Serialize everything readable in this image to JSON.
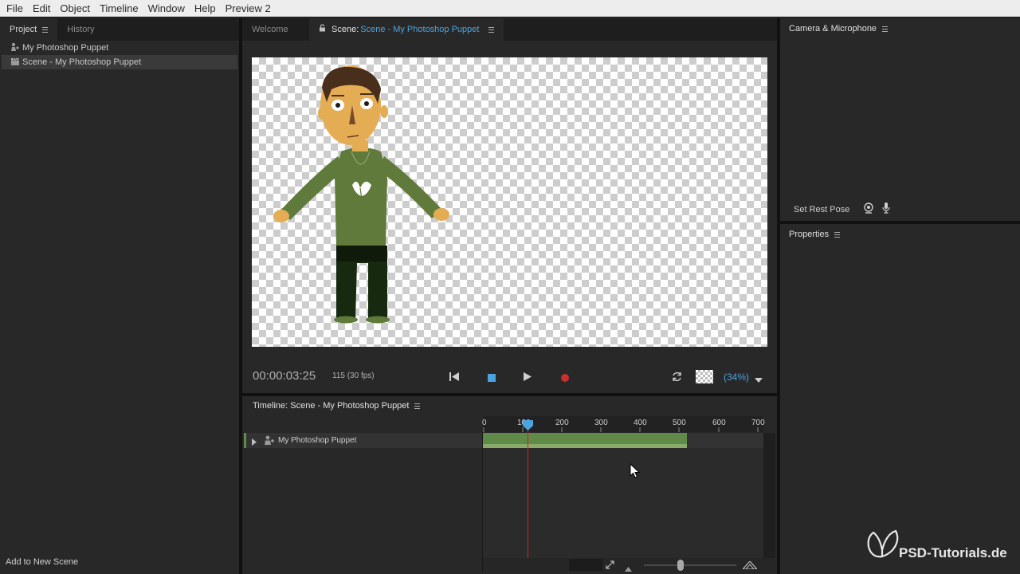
{
  "menu": [
    "File",
    "Edit",
    "Object",
    "Timeline",
    "Window",
    "Help",
    "Preview 2"
  ],
  "left_panel": {
    "tabs": [
      "Project",
      "History"
    ],
    "items": [
      "My Photoshop Puppet",
      "Scene - My Photoshop Puppet"
    ],
    "footer": "Add to New Scene"
  },
  "scene_panel": {
    "tab_welcome": "Welcome",
    "tab_scene_prefix": "Scene:",
    "tab_scene_name": "Scene - My Photoshop Puppet",
    "timecode": "00:00:03:25",
    "frame_info": "115 (30 fps)",
    "zoom": "(34%)"
  },
  "camera_panel": {
    "title": "Camera & Microphone",
    "set_rest_pose": "Set Rest Pose"
  },
  "properties_panel": {
    "title": "Properties"
  },
  "timeline": {
    "title": "Timeline: Scene - My Photoshop Puppet",
    "ruler": [
      "0",
      "100",
      "200",
      "300",
      "400",
      "500",
      "600",
      "700"
    ],
    "track_name": "My Photoshop Puppet",
    "playhead_frame": 115
  },
  "watermark": "PSD-Tutorials.de",
  "colors": {
    "accent": "#4aa3df",
    "record": "#c9302c",
    "track_bar": "#5f8a4a",
    "playhead": "#d0202a"
  }
}
